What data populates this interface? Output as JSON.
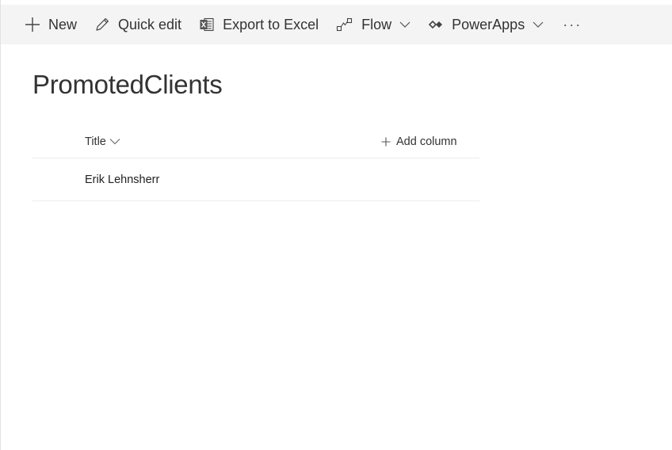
{
  "commandbar": {
    "new_label": "New",
    "quick_edit_label": "Quick edit",
    "export_label": "Export to Excel",
    "flow_label": "Flow",
    "powerapps_label": "PowerApps",
    "more_label": "···"
  },
  "page": {
    "title": "PromotedClients"
  },
  "list": {
    "columns": {
      "title": "Title",
      "add_column": "Add column"
    },
    "rows": [
      {
        "title": "Erik Lehnsherr"
      }
    ]
  },
  "icons": {
    "new": "plus-icon",
    "quick_edit": "pencil-icon",
    "export": "excel-icon",
    "flow": "flow-icon",
    "powerapps": "powerapps-icon",
    "dropdown": "chevron-down-icon"
  },
  "colors": {
    "commandbar_bg": "#f4f4f4",
    "text": "#333333",
    "divider": "#eaeaea"
  }
}
